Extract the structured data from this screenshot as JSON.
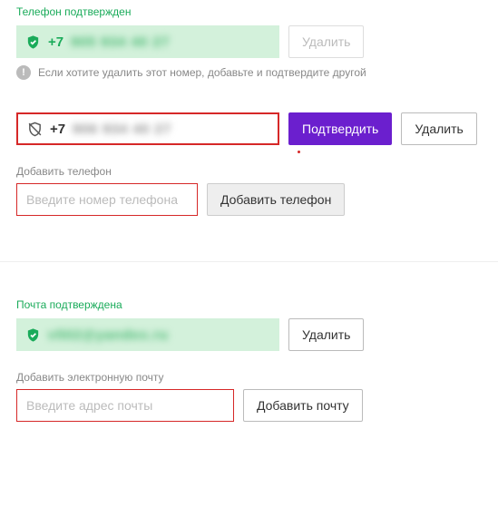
{
  "phone_section": {
    "confirmed_label": "Телефон подтвержден",
    "confirmed_prefix": "+7",
    "confirmed_rest": "905 934 40 27",
    "delete_disabled": "Удалить",
    "info_text": "Если хотите удалить этот номер, добавьте и подтвердите другой",
    "unconfirmed_prefix": "+7",
    "unconfirmed_rest": "906 934 40 27",
    "confirm_btn": "Подтвердить",
    "delete_btn": "Удалить",
    "add_label": "Добавить телефон",
    "add_placeholder": "Введите номер телефона",
    "add_btn": "Добавить телефон"
  },
  "email_section": {
    "confirmed_label": "Почта подтверждена",
    "email_masked": "v502@yandex.ru",
    "delete_btn": "Удалить",
    "add_label": "Добавить электронную почту",
    "add_placeholder": "Введите адрес почты",
    "add_btn": "Добавить почту"
  }
}
